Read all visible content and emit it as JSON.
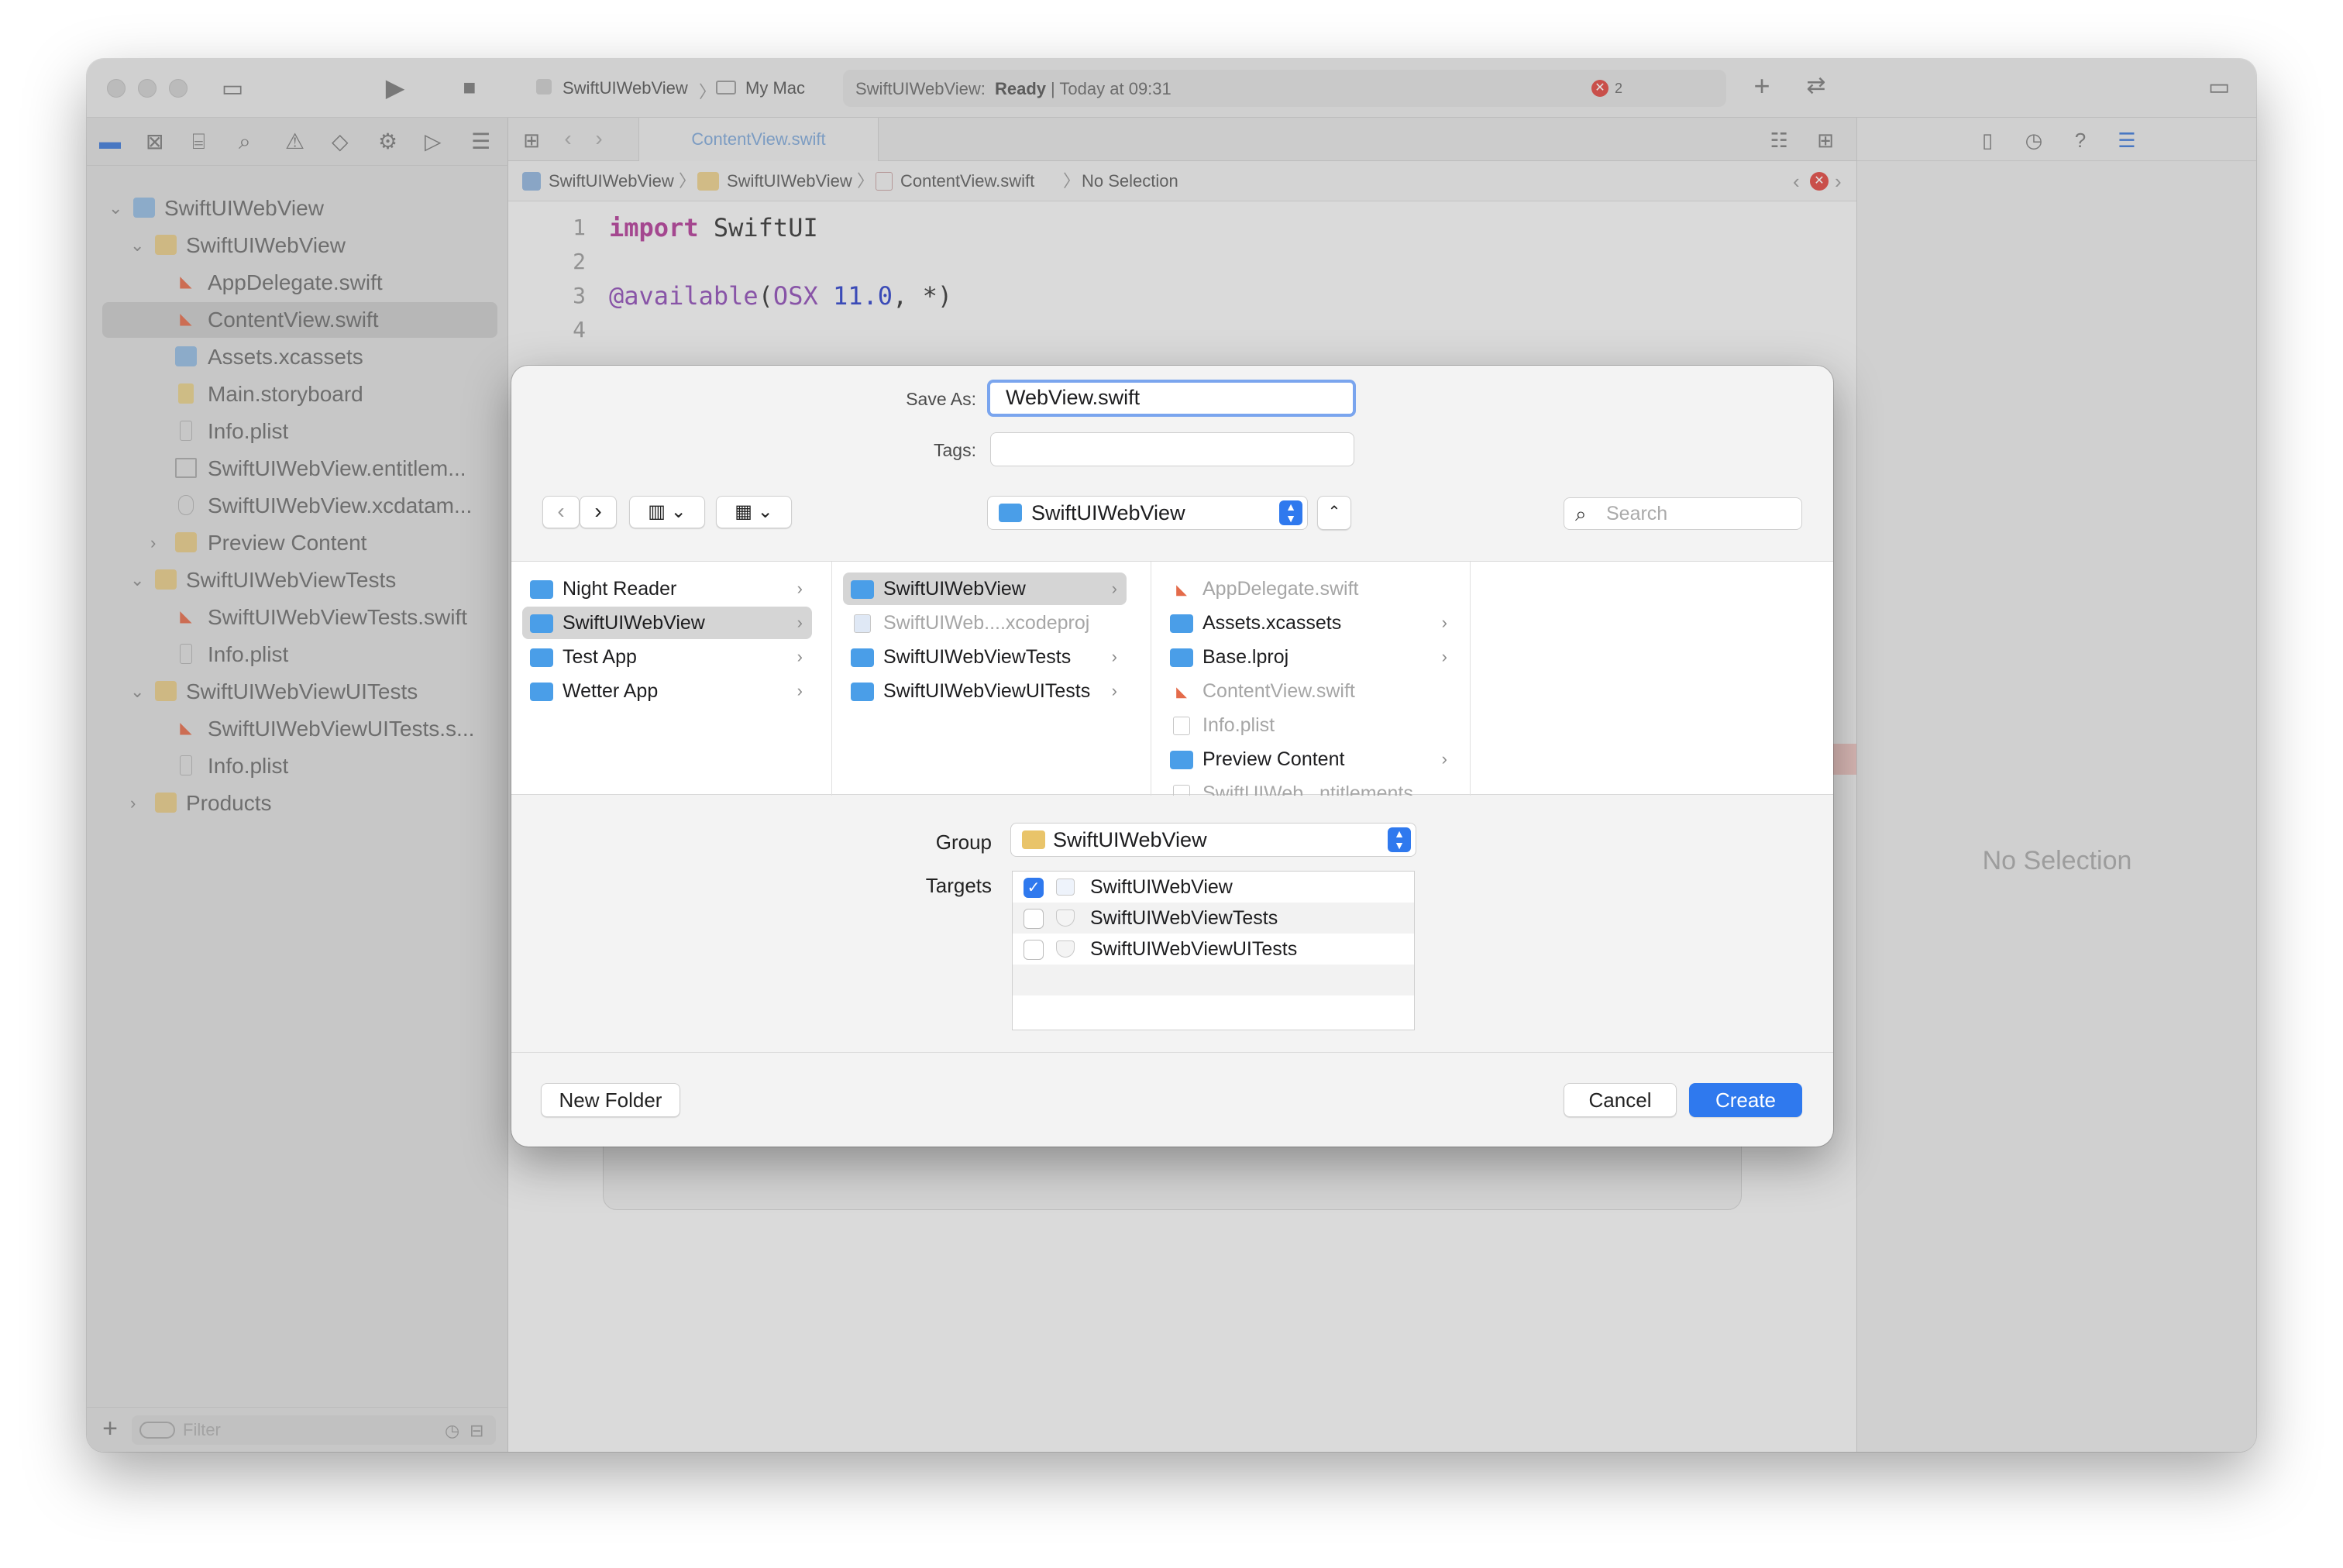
{
  "toolbar": {
    "scheme": "SwiftUIWebView",
    "destination": "My Mac",
    "status_prefix": "SwiftUIWebView:",
    "status_state": "Ready",
    "status_time": "| Today at 09:31",
    "error_count": "2"
  },
  "sidebar": {
    "project": "SwiftUIWebView",
    "items": [
      {
        "label": "SwiftUIWebView"
      },
      {
        "label": "AppDelegate.swift"
      },
      {
        "label": "ContentView.swift"
      },
      {
        "label": "Assets.xcassets"
      },
      {
        "label": "Main.storyboard"
      },
      {
        "label": "Info.plist"
      },
      {
        "label": "SwiftUIWebView.entitlem..."
      },
      {
        "label": "SwiftUIWebView.xcdatam..."
      },
      {
        "label": "Preview Content"
      },
      {
        "label": "SwiftUIWebViewTests"
      },
      {
        "label": "SwiftUIWebViewTests.swift"
      },
      {
        "label": "Info.plist"
      },
      {
        "label": "SwiftUIWebViewUITests"
      },
      {
        "label": "SwiftUIWebViewUITests.s..."
      },
      {
        "label": "Info.plist"
      },
      {
        "label": "Products"
      }
    ],
    "filter_placeholder": "Filter"
  },
  "editor": {
    "tab": "ContentView.swift",
    "jump": [
      "SwiftUIWebView",
      "SwiftUIWebView",
      "ContentView.swift",
      "No Selection"
    ],
    "lines": [
      {
        "n": "1",
        "kw": "import",
        "rest": " SwiftUI"
      },
      {
        "n": "2"
      },
      {
        "n": "3",
        "at": "@available",
        "p1": "(",
        "os": "OSX",
        "sp": " ",
        "num": "11.0",
        "p2": ", *)"
      },
      {
        "n": "4"
      }
    ]
  },
  "inspector": {
    "no_selection": "No Selection"
  },
  "dialog": {
    "save_as_label": "Save As:",
    "save_as_value": "WebView.swift",
    "tags_label": "Tags:",
    "location": "SwiftUIWebView",
    "search_placeholder": "Search",
    "col1": [
      "Night Reader",
      "SwiftUIWebView",
      "Test App",
      "Wetter App"
    ],
    "col2": [
      "SwiftUIWebView",
      "SwiftUIWeb....xcodeproj",
      "SwiftUIWebViewTests",
      "SwiftUIWebViewUITests"
    ],
    "col3": [
      "AppDelegate.swift",
      "Assets.xcassets",
      "Base.lproj",
      "ContentView.swift",
      "Info.plist",
      "Preview Content",
      "SwiftUIWeb...ntitlements"
    ],
    "group_label": "Group",
    "group_value": "SwiftUIWebView",
    "targets_label": "Targets",
    "targets": [
      "SwiftUIWebView",
      "SwiftUIWebViewTests",
      "SwiftUIWebViewUITests"
    ],
    "new_folder": "New Folder",
    "cancel": "Cancel",
    "create": "Create"
  },
  "colors": {
    "accent": "#2f79ee",
    "folder": "#4a9ee8",
    "swift": "#e46b4a",
    "error": "#e0443e"
  }
}
